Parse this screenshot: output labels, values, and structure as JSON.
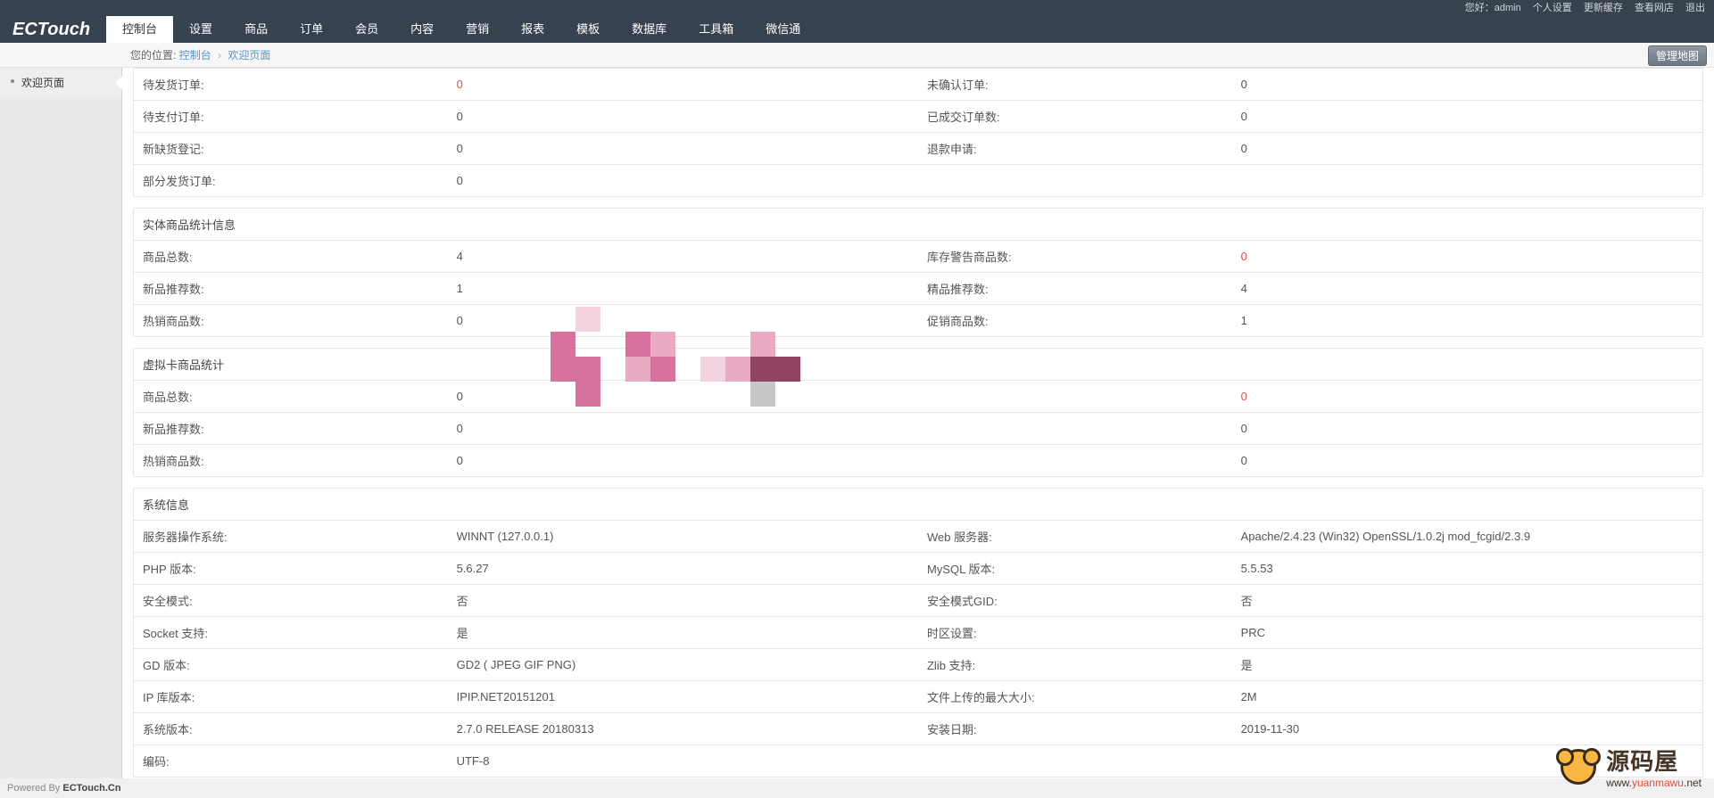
{
  "topbar": {
    "greeting": "您好：admin",
    "links": [
      "个人设置",
      "更新缓存",
      "查看网店",
      "退出"
    ]
  },
  "logo": "ECTouch",
  "nav": [
    "控制台",
    "设置",
    "商品",
    "订单",
    "会员",
    "内容",
    "营销",
    "报表",
    "模板",
    "数据库",
    "工具箱",
    "微信通"
  ],
  "breadcrumb": {
    "prefix": "您的位置:",
    "items": [
      "控制台",
      "欢迎页面"
    ]
  },
  "map_button": "管理地图",
  "sidebar": {
    "items": [
      {
        "label": "欢迎页面"
      }
    ]
  },
  "orders": {
    "rows": [
      {
        "l1": "待发货订单:",
        "v1": "0",
        "v1_red": true,
        "l2": "未确认订单:",
        "v2": "0"
      },
      {
        "l1": "待支付订单:",
        "v1": "0",
        "l2": "已成交订单数:",
        "v2": "0"
      },
      {
        "l1": "新缺货登记:",
        "v1": "0",
        "l2": "退款申请:",
        "v2": "0"
      },
      {
        "l1": "部分发货订单:",
        "v1": "0",
        "l2": "",
        "v2": ""
      }
    ]
  },
  "physical": {
    "title": "实体商品统计信息",
    "rows": [
      {
        "l1": "商品总数:",
        "v1": "4",
        "l2": "库存警告商品数:",
        "v2": "0",
        "v2_red": true
      },
      {
        "l1": "新品推荐数:",
        "v1": "1",
        "l2": "精品推荐数:",
        "v2": "4"
      },
      {
        "l1": "热销商品数:",
        "v1": "0",
        "l2": "促销商品数:",
        "v2": "1"
      }
    ]
  },
  "virtual": {
    "title": "虚拟卡商品统计",
    "rows": [
      {
        "l1": "商品总数:",
        "v1": "0",
        "l2": "",
        "v2": "0",
        "v2_red": true
      },
      {
        "l1": "新品推荐数:",
        "v1": "0",
        "l2": "",
        "v2": "0"
      },
      {
        "l1": "热销商品数:",
        "v1": "0",
        "l2": "",
        "v2": "0"
      }
    ]
  },
  "system": {
    "title": "系统信息",
    "rows": [
      {
        "l1": "服务器操作系统:",
        "v1": "WINNT (127.0.0.1)",
        "l2": "Web 服务器:",
        "v2": "Apache/2.4.23 (Win32) OpenSSL/1.0.2j mod_fcgid/2.3.9"
      },
      {
        "l1": "PHP 版本:",
        "v1": "5.6.27",
        "l2": "MySQL 版本:",
        "v2": "5.5.53"
      },
      {
        "l1": "安全模式:",
        "v1": "否",
        "l2": "安全模式GID:",
        "v2": "否"
      },
      {
        "l1": "Socket 支持:",
        "v1": "是",
        "l2": "时区设置:",
        "v2": "PRC"
      },
      {
        "l1": "GD 版本:",
        "v1": "GD2 ( JPEG GIF PNG)",
        "l2": "Zlib 支持:",
        "v2": "是"
      },
      {
        "l1": "IP 库版本:",
        "v1": "IPIP.NET20151201",
        "l2": "文件上传的最大大小:",
        "v2": "2M"
      },
      {
        "l1": "系统版本:",
        "v1": "2.7.0 RELEASE 20180313",
        "l2": "安装日期:",
        "v2": "2019-11-30"
      },
      {
        "l1": "编码:",
        "v1": "UTF-8",
        "l2": "",
        "v2": ""
      }
    ]
  },
  "footer": {
    "text": "Powered By ",
    "brand": "ECTouch.Cn"
  },
  "watermark": {
    "cn": "源码屋",
    "en_pre": "www.",
    "en_mid": "yuanmawu",
    "en_post": ".net"
  }
}
